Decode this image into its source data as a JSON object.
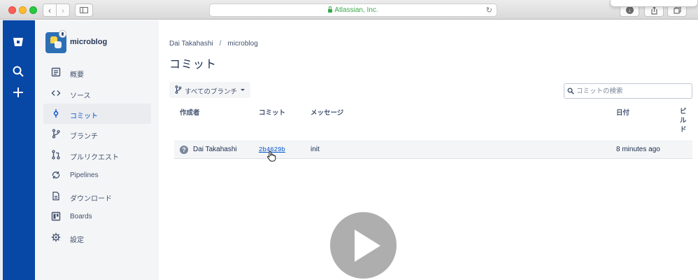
{
  "browser": {
    "url_text": "Atlassian, Inc."
  },
  "project": {
    "name": "microblog"
  },
  "sidebar": {
    "items": [
      {
        "label": "概要",
        "icon": "overview-icon",
        "active": false
      },
      {
        "label": "ソース",
        "icon": "source-code-icon",
        "active": false
      },
      {
        "label": "コミット",
        "icon": "commit-icon",
        "active": true
      },
      {
        "label": "ブランチ",
        "icon": "branch-icon",
        "active": false
      },
      {
        "label": "プルリクエスト",
        "icon": "pull-request-icon",
        "active": false
      },
      {
        "label": "Pipelines",
        "icon": "pipelines-icon",
        "active": false
      },
      {
        "label": "ダウンロード",
        "icon": "download-icon",
        "active": false
      },
      {
        "label": "Boards",
        "icon": "boards-icon",
        "active": false
      },
      {
        "label": "設定",
        "icon": "settings-icon",
        "active": false
      }
    ]
  },
  "breadcrumb": {
    "owner": "Dai Takahashi",
    "separator": "/",
    "repo": "microblog"
  },
  "page": {
    "title": "コミット"
  },
  "filters": {
    "branch_label": "すべてのブランチ",
    "search_placeholder": "コミットの検索"
  },
  "table": {
    "headers": {
      "author": "作成者",
      "commit": "コミット",
      "message": "メッセージ",
      "date": "日付",
      "build": "ビルド"
    },
    "rows": [
      {
        "avatar": "?",
        "author": "Dai Takahashi",
        "hash": "2b4629b",
        "message": "init",
        "date": "8 minutes ago"
      }
    ]
  },
  "colors": {
    "global_nav": "#0747a6",
    "sidebar_bg": "#f4f5f7",
    "link": "#0052cc",
    "text": "#172b4d"
  }
}
